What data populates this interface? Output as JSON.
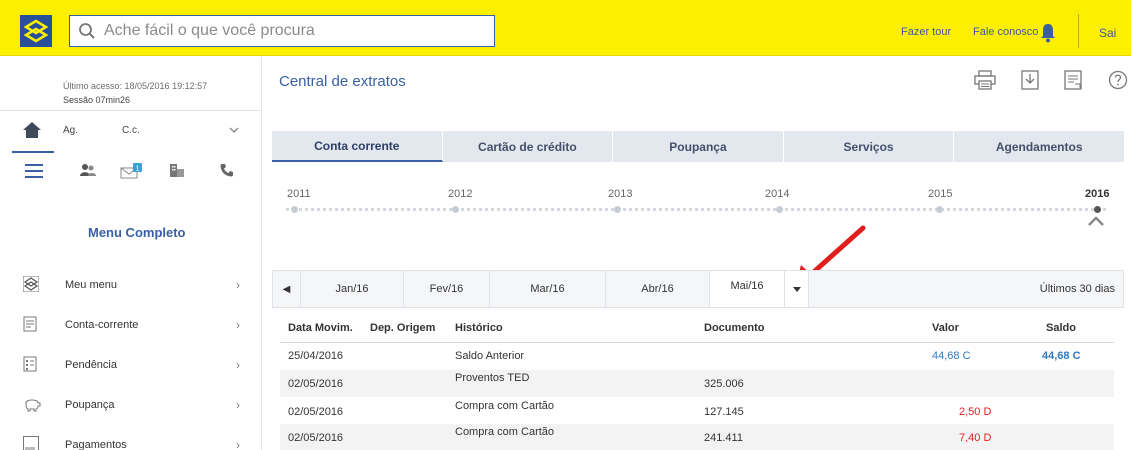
{
  "header": {
    "search_placeholder": "Ache fácil o que você procura",
    "tour_link": "Fazer tour",
    "contact_link": "Fale conosco",
    "logout_label": "Sai"
  },
  "session": {
    "last_access": "Último acesso: 18/05/2016 19:12:57",
    "session_time": "Sessão 07min26"
  },
  "account": {
    "agency_label": "Ag.",
    "account_label": "C.c."
  },
  "notifications": {
    "mail_badge": "1"
  },
  "menu": {
    "title": "Menu Completo",
    "items": [
      {
        "label": "Meu menu",
        "icon": "bb-logo-icon"
      },
      {
        "label": "Conta-corrente",
        "icon": "document-icon"
      },
      {
        "label": "Pendência",
        "icon": "checklist-icon"
      },
      {
        "label": "Poupança",
        "icon": "piggy-bank-icon"
      },
      {
        "label": "Pagamentos",
        "icon": "barcode-icon"
      }
    ]
  },
  "page": {
    "title": "Central de extratos"
  },
  "tabs": [
    {
      "label": "Conta corrente",
      "active": true
    },
    {
      "label": "Cartão de crédito",
      "active": false
    },
    {
      "label": "Poupança",
      "active": false
    },
    {
      "label": "Serviços",
      "active": false
    },
    {
      "label": "Agendamentos",
      "active": false
    }
  ],
  "timeline": {
    "years": [
      "2011",
      "2012",
      "2013",
      "2014",
      "2015",
      "2016"
    ],
    "selected": "2016"
  },
  "months": {
    "items": [
      "Jan/16",
      "Fev/16",
      "Mar/16",
      "Abr/16"
    ],
    "selected": "Mai/16",
    "last_30_days": "Últimos 30 dias"
  },
  "statement": {
    "columns": [
      "Data Movim.",
      "Dep. Origem",
      "Histórico",
      "Documento",
      "Valor",
      "Saldo"
    ],
    "rows": [
      {
        "date": "25/04/2016",
        "origin": "",
        "history": "Saldo Anterior",
        "document": "",
        "value": "44,68 C",
        "balance": "44,68 C"
      },
      {
        "date": "02/05/2016",
        "origin": "",
        "history": "Proventos TED",
        "document": "325.006",
        "value": "",
        "balance": ""
      },
      {
        "date": "02/05/2016",
        "origin": "",
        "history": "Compra com Cartão",
        "document": "127.145",
        "value": "2,50 D",
        "balance": ""
      },
      {
        "date": "02/05/2016",
        "origin": "",
        "history": "Compra com Cartão",
        "document": "241.411",
        "value": "7,40 D",
        "balance": ""
      }
    ]
  },
  "colors": {
    "brand_yellow": "#fcf000",
    "brand_blue": "#3a5fa5",
    "credit_blue": "#2f7bc1",
    "debit_red": "#e02020"
  }
}
